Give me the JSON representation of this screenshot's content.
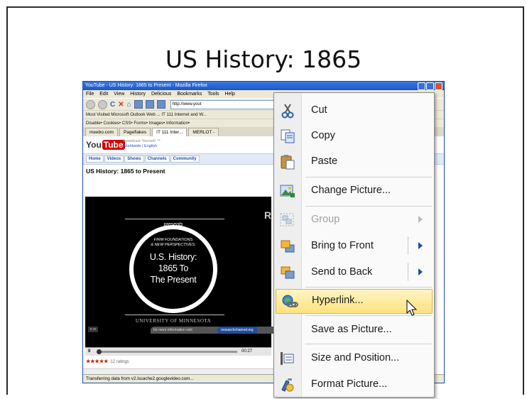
{
  "slide": {
    "title": "US History: 1865"
  },
  "browser": {
    "title": "YouTube - US History: 1865 to Present - Mozilla Firefox",
    "menu": [
      "File",
      "Edit",
      "View",
      "History",
      "Delicious",
      "Bookmarks",
      "Tools",
      "Help"
    ],
    "url": "http://www.yout",
    "bookmarks": "Most Visited   Microsoft Outlook Web ...   IT 111 Internet and W...",
    "toolbar2": "Disable•  Cookies•  CSS•  Forms•  Images•  Information•",
    "tabs": [
      "meebo.com",
      "Pageflakes",
      "IT 111 Inter...",
      "MERLOT -"
    ],
    "status": "Transferring data from v2.lscache2.googlevideo.com..."
  },
  "youtube": {
    "logo_you": "You",
    "logo_tube": "Tube",
    "tagline": "Broadcast Yourself ™",
    "locale": "Worldwide | English",
    "nav": [
      "Home",
      "Videos",
      "Shows",
      "Channels",
      "Community"
    ],
    "video_title": "US History: 1865 to Present",
    "video": {
      "presents": "presents",
      "series": "FIRM FOUNDATIONS",
      "series2": "& NEW PERSPECTIVES:",
      "line1": "U.S. History:",
      "line2": "1865 To",
      "line3": "The Present",
      "university": "UNIVERSITY OF MINNESOTA",
      "info": "for more information visit",
      "channel": "researchchannel.org",
      "time_badge": "0:20",
      "logo": "R"
    },
    "player_time": "00:27",
    "pause_glyph": "II",
    "stars": "★★★★★",
    "ratings": "12 ratings"
  },
  "context_menu": {
    "items": [
      {
        "label": "Cut",
        "icon": "scissors-icon"
      },
      {
        "label": "Copy",
        "icon": "copy-icon"
      },
      {
        "label": "Paste",
        "icon": "paste-icon"
      },
      {
        "label": "Change Picture...",
        "icon": "change-picture-icon"
      },
      {
        "label": "Group",
        "icon": "group-icon",
        "disabled": true
      },
      {
        "label": "Bring to Front",
        "icon": "bring-to-front-icon"
      },
      {
        "label": "Send to Back",
        "icon": "send-to-back-icon"
      },
      {
        "label": "Hyperlink...",
        "icon": "hyperlink-icon",
        "highlighted": true
      },
      {
        "label": "Save as Picture...",
        "icon": "save-as-picture-icon"
      },
      {
        "label": "Size and Position...",
        "icon": "size-position-icon"
      },
      {
        "label": "Format Picture...",
        "icon": "format-picture-icon"
      }
    ]
  },
  "colors": {
    "highlight": "#ffe37e",
    "menu_arrow": "#1b4f9c",
    "titlebar": "#1d56c6"
  }
}
